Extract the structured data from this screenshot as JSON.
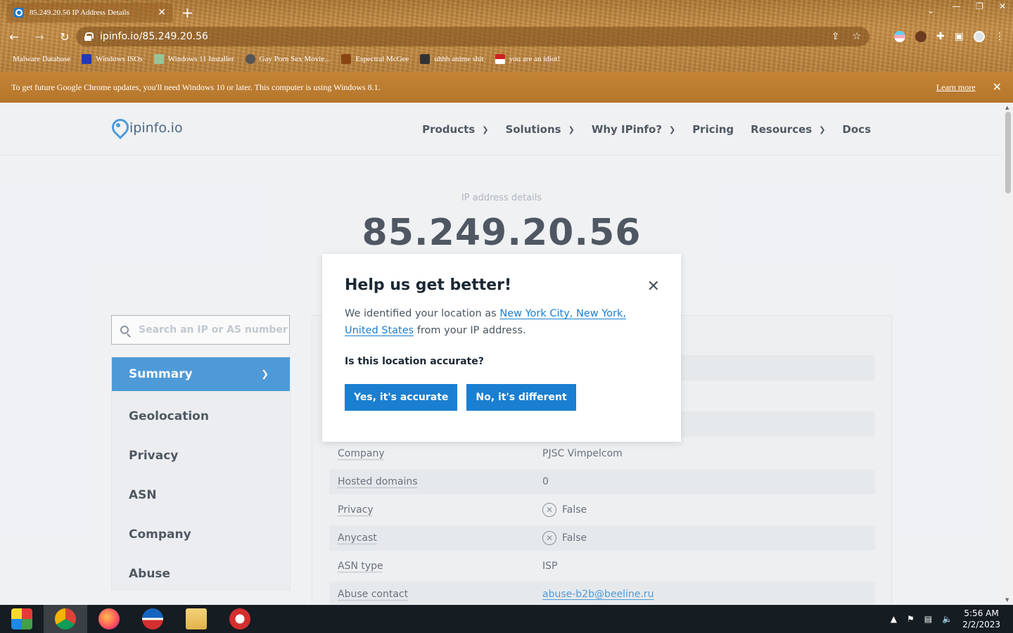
{
  "browser": {
    "tab_title": "85.249.20.56 IP Address Details",
    "url": "ipinfo.io/85.249.20.56",
    "bookmarks": [
      {
        "label": "Malware Database",
        "color": "#b07a34"
      },
      {
        "label": "Windows ISOs",
        "color": "#1f3bb3"
      },
      {
        "label": "Windows 11 Installer",
        "color": "#2e8b57"
      },
      {
        "label": "Gay Porn Sex Movie...",
        "color": "#555555"
      },
      {
        "label": "Espectral McGee",
        "color": "#8b4513"
      },
      {
        "label": "uhhh anime shit",
        "color": "#333333"
      },
      {
        "label": "you are an idiot!",
        "color": "#cc2222"
      }
    ]
  },
  "update_bar": {
    "message": "To get future Google Chrome updates, you'll need Windows 10 or later. This computer is using Windows 8.1.",
    "learn_more": "Learn more"
  },
  "site": {
    "logo": "ipinfo.io",
    "nav": {
      "products": "Products",
      "solutions": "Solutions",
      "why": "Why IPinfo?",
      "pricing": "Pricing",
      "resources": "Resources",
      "docs": "Docs"
    }
  },
  "hero": {
    "subtitle": "IP address details",
    "ip": "85.249.20.56"
  },
  "search": {
    "placeholder": "Search an IP or AS number"
  },
  "sidebar": {
    "items": [
      "Summary",
      "Geolocation",
      "Privacy",
      "ASN",
      "Company",
      "Abuse"
    ]
  },
  "details": {
    "rows": [
      {
        "key": "Company",
        "value": "PJSC Vimpelcom"
      },
      {
        "key": "Hosted domains",
        "value": "0"
      },
      {
        "key": "Privacy",
        "value": "False"
      },
      {
        "key": "Anycast",
        "value": "False"
      },
      {
        "key": "ASN type",
        "value": "ISP"
      },
      {
        "key": "Abuse contact",
        "value": "abuse-b2b@beeline.ru"
      }
    ]
  },
  "modal": {
    "title": "Help us get better!",
    "text_before": "We identified your location as ",
    "location": "New York City, New York, United States",
    "text_after": " from your IP address.",
    "question": "Is this location accurate?",
    "yes": "Yes, it's accurate",
    "no": "No, it's different"
  },
  "taskbar": {
    "time": "5:56 AM",
    "date": "2/2/2023"
  }
}
